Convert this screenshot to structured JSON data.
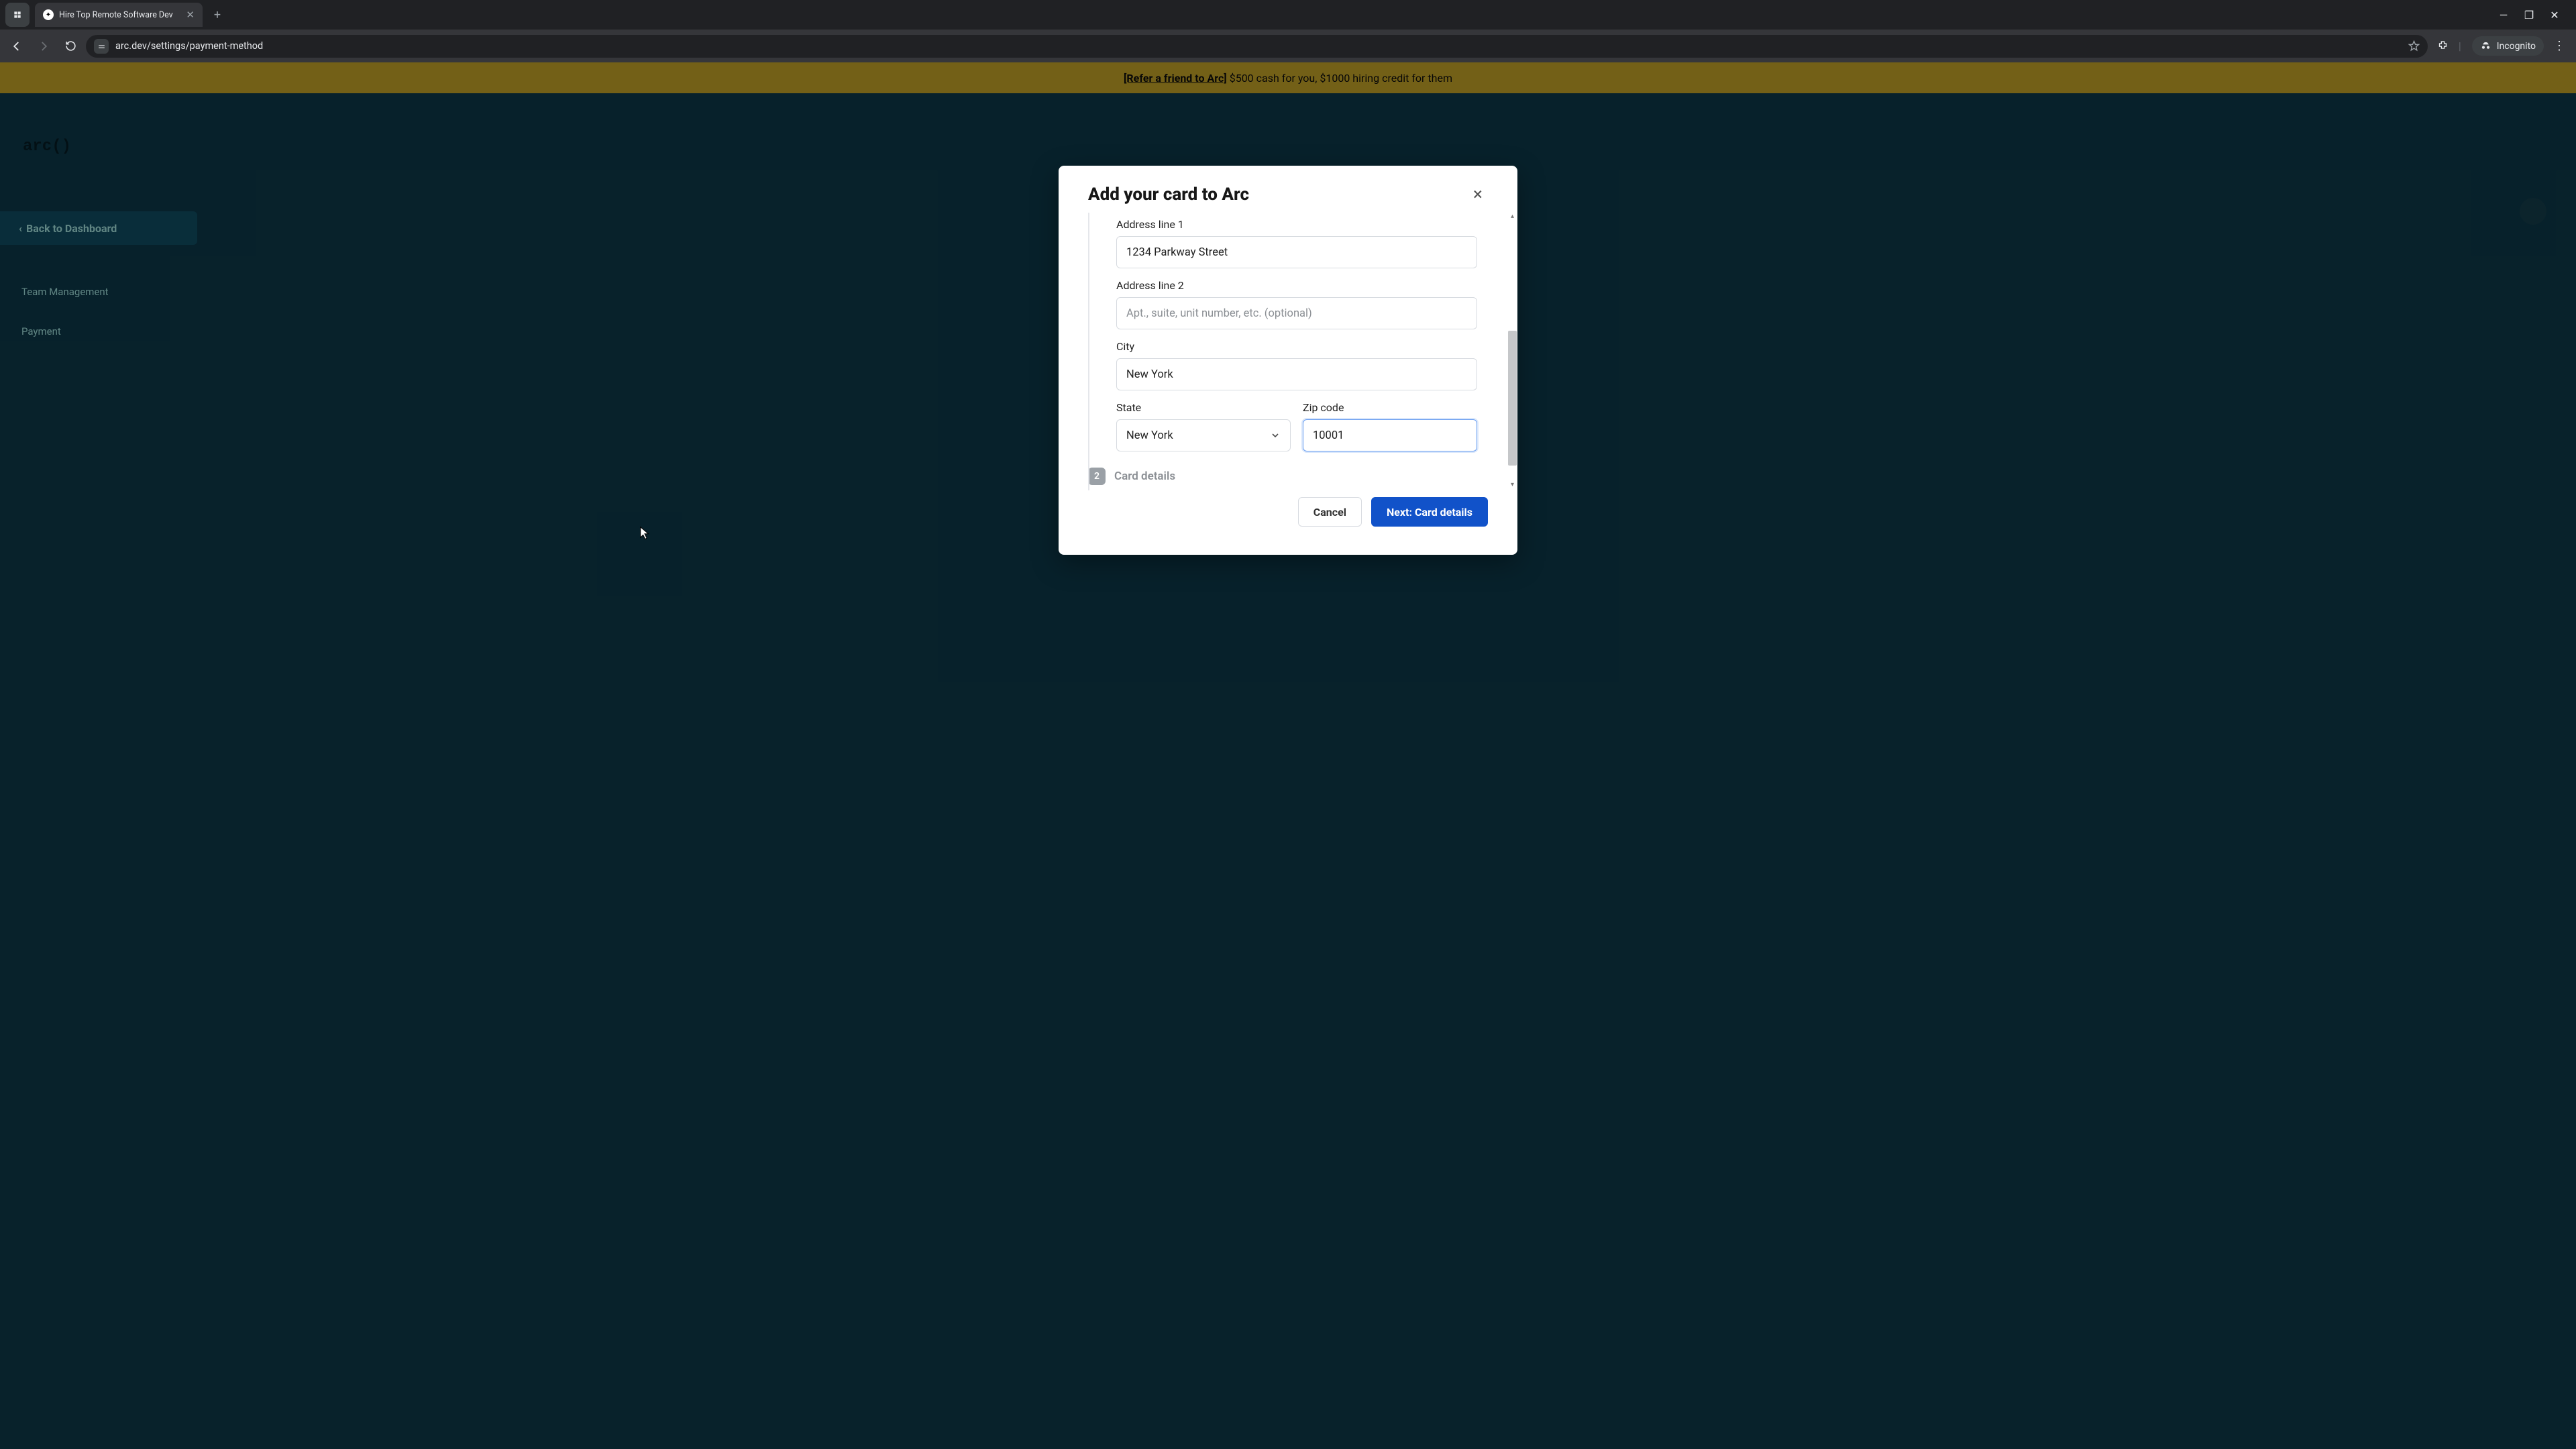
{
  "browser": {
    "tab_title": "Hire Top Remote Software Dev",
    "url": "arc.dev/settings/payment-method",
    "incognito_label": "Incognito"
  },
  "banner": {
    "link_text": "[Refer a friend to Arc]",
    "rest_text": " $500 cash for you, $1000 hiring credit for them"
  },
  "bg": {
    "logo": "arc()",
    "back": "Back to Dashboard",
    "link1": "Team Management",
    "link2": "Payment"
  },
  "modal": {
    "title": "Add your card to Arc",
    "close": "×",
    "addr1_label": "Address line 1",
    "addr1_value": "1234 Parkway Street",
    "addr2_label": "Address line 2",
    "addr2_placeholder": "Apt., suite, unit number, etc. (optional)",
    "city_label": "City",
    "city_value": "New York",
    "state_label": "State",
    "state_value": "New York",
    "zip_label": "Zip code",
    "zip_value": "10001",
    "step2_num": "2",
    "step2_label": "Card details",
    "cancel": "Cancel",
    "next": "Next: Card details"
  }
}
